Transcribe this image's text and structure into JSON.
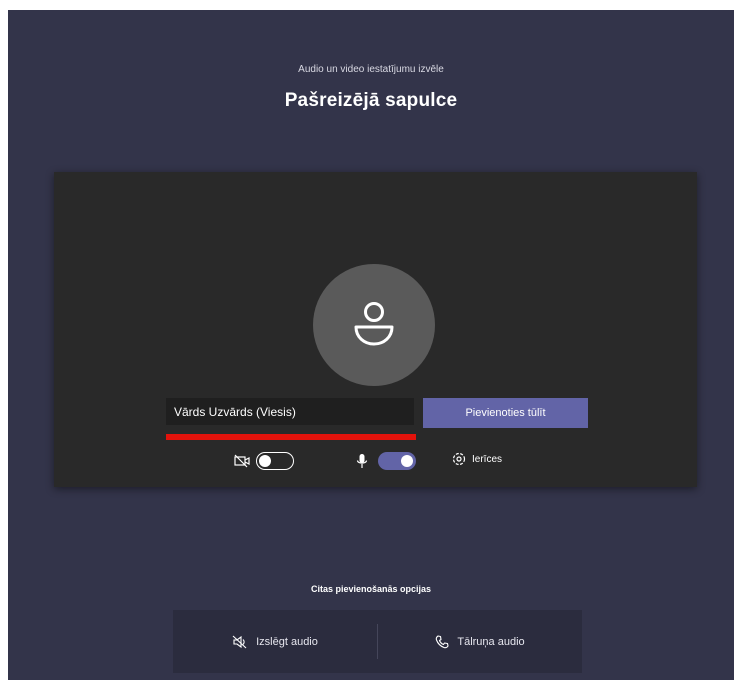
{
  "header": {
    "subtitle": "Audio un video iestatījumu izvēle",
    "title": "Pašreizējā sapulce"
  },
  "preview": {
    "avatar_icon": "person-icon",
    "name_value": "Vārds Uzvārds (Viesis)",
    "join_label": "Pievienoties tūlīt"
  },
  "controls": {
    "camera": {
      "icon": "camera-off-icon",
      "state": "off"
    },
    "mic": {
      "icon": "microphone-icon",
      "state": "on"
    },
    "devices_label": "Ierīces",
    "devices_icon": "gear-icon"
  },
  "other_options": {
    "title": "Citas pievienošanās opcijas",
    "items": [
      {
        "label": "Izslēgt audio",
        "icon": "speaker-off-icon"
      },
      {
        "label": "Tālruņa audio",
        "icon": "phone-icon"
      }
    ]
  },
  "colors": {
    "background": "#33344a",
    "preview": "#292929",
    "accent": "#6264a7",
    "highlight": "#e3120b"
  }
}
